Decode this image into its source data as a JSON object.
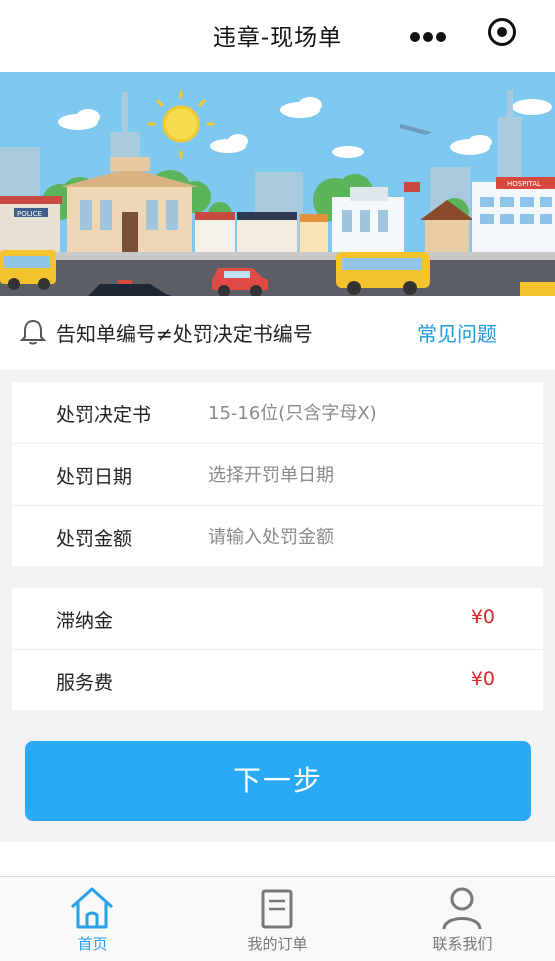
{
  "navbar": {
    "title": "违章-现场单"
  },
  "banner": {
    "police_sign": "POLICE",
    "hospital_sign": "HOSPITAL"
  },
  "notice": {
    "text": "告知单编号≠处罚决定书编号",
    "faq_label": "常见问题"
  },
  "form": {
    "decision": {
      "label": "处罚决定书",
      "placeholder": "15-16位(只含字母X)"
    },
    "date": {
      "label": "处罚日期",
      "placeholder": "选择开罚单日期"
    },
    "amount": {
      "label": "处罚金额",
      "placeholder": "请输入处罚金额"
    }
  },
  "fees": {
    "late_fee": {
      "label": "滞纳金",
      "value": "¥0"
    },
    "service_fee": {
      "label": "服务费",
      "value": "¥0"
    }
  },
  "next_button": {
    "label": "下一步"
  },
  "tabbar": {
    "items": [
      {
        "label": "首页",
        "icon": "home-icon",
        "active": true
      },
      {
        "label": "我的订单",
        "icon": "order-icon",
        "active": false
      },
      {
        "label": "联系我们",
        "icon": "user-icon",
        "active": false
      }
    ]
  },
  "colors": {
    "accent": "#2aaaf5",
    "link": "#1e9bd7",
    "price": "#d9262c",
    "active_tab": "#2aa0e6"
  }
}
